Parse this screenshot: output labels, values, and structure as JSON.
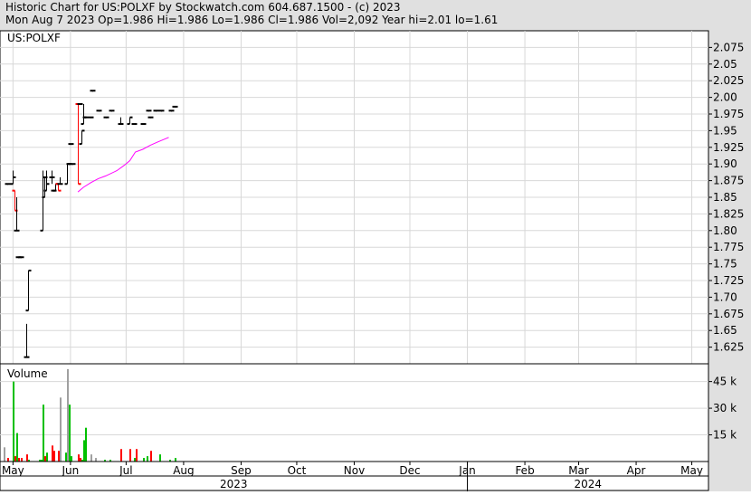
{
  "header": {
    "line1": "Historic Chart for US:POLXF by Stockwatch.com 604.687.1500 - (c) 2023",
    "line2": "Mon Aug  7 2023  Op=1.986  Hi=1.986  Lo=1.986  Cl=1.986  Vol=2,092  Year hi=2.01  lo=1.61"
  },
  "colors": {
    "frame_bg": "#e0e0e0",
    "plot_bg": "#ffffff",
    "grid": "#d8d8d8",
    "up": "#000000",
    "down": "#ff0000",
    "moving_average": "#ff00ff",
    "vol_up": "#00c000",
    "vol_down": "#ff0000",
    "vol_neutral": "#a0a0a0"
  },
  "chart_data": [
    {
      "type": "ohlc",
      "title": "US:POLXF",
      "ylim": [
        1.6,
        2.1
      ],
      "yticks": [
        "2.075",
        "2.05",
        "2.025",
        "2.00",
        "1.975",
        "1.95",
        "1.925",
        "1.90",
        "1.875",
        "1.85",
        "1.825",
        "1.80",
        "1.775",
        "1.75",
        "1.725",
        "1.70",
        "1.675",
        "1.65",
        "1.625"
      ],
      "grid": true,
      "bars": [
        {
          "date": "2023-04-28",
          "open": 1.87,
          "high": 1.87,
          "low": 1.87,
          "close": 1.87
        },
        {
          "date": "2023-05-01",
          "open": 1.87,
          "high": 1.89,
          "low": 1.87,
          "close": 1.88
        },
        {
          "date": "2023-05-02",
          "open": 1.86,
          "high": 1.86,
          "low": 1.83,
          "close": 1.83
        },
        {
          "date": "2023-05-03",
          "open": 1.8,
          "high": 1.85,
          "low": 1.8,
          "close": 1.8
        },
        {
          "date": "2023-05-04",
          "open": 1.76,
          "high": 1.76,
          "low": 1.76,
          "close": 1.76
        },
        {
          "date": "2023-05-05",
          "open": 1.76,
          "high": 1.76,
          "low": 1.76,
          "close": 1.76
        },
        {
          "date": "2023-05-08",
          "open": 1.61,
          "high": 1.66,
          "low": 1.61,
          "close": 1.61
        },
        {
          "date": "2023-05-09",
          "open": 1.68,
          "high": 1.74,
          "low": 1.68,
          "close": 1.74
        },
        {
          "date": "2023-05-17",
          "open": 1.8,
          "high": 1.89,
          "low": 1.8,
          "close": 1.88
        },
        {
          "date": "2023-05-18",
          "open": 1.85,
          "high": 1.88,
          "low": 1.85,
          "close": 1.88
        },
        {
          "date": "2023-05-19",
          "open": 1.86,
          "high": 1.89,
          "low": 1.86,
          "close": 1.87
        },
        {
          "date": "2023-05-22",
          "open": 1.88,
          "high": 1.89,
          "low": 1.87,
          "close": 1.88
        },
        {
          "date": "2023-05-23",
          "open": 1.86,
          "high": 1.86,
          "low": 1.86,
          "close": 1.86
        },
        {
          "date": "2023-05-24",
          "open": 1.86,
          "high": 1.87,
          "low": 1.86,
          "close": 1.87
        },
        {
          "date": "2023-05-25",
          "open": 1.87,
          "high": 1.87,
          "low": 1.86,
          "close": 1.86
        },
        {
          "date": "2023-05-26",
          "open": 1.87,
          "high": 1.88,
          "low": 1.87,
          "close": 1.87
        },
        {
          "date": "2023-05-30",
          "open": 1.87,
          "high": 1.9,
          "low": 1.87,
          "close": 1.9
        },
        {
          "date": "2023-05-31",
          "open": 1.9,
          "high": 1.9,
          "low": 1.9,
          "close": 1.9
        },
        {
          "date": "2023-06-01",
          "open": 1.93,
          "high": 1.93,
          "low": 1.93,
          "close": 1.93
        },
        {
          "date": "2023-06-02",
          "open": 1.9,
          "high": 1.9,
          "low": 1.9,
          "close": 1.9
        },
        {
          "date": "2023-06-05",
          "open": 1.99,
          "high": 1.99,
          "low": 1.87,
          "close": 1.87
        },
        {
          "date": "2023-06-06",
          "open": 1.99,
          "high": 1.99,
          "low": 1.99,
          "close": 1.99
        },
        {
          "date": "2023-06-07",
          "open": 1.93,
          "high": 1.95,
          "low": 1.93,
          "close": 1.95
        },
        {
          "date": "2023-06-08",
          "open": 1.96,
          "high": 1.99,
          "low": 1.96,
          "close": 1.97
        },
        {
          "date": "2023-06-09",
          "open": 1.97,
          "high": 1.97,
          "low": 1.97,
          "close": 1.97
        },
        {
          "date": "2023-06-12",
          "open": 1.97,
          "high": 1.97,
          "low": 1.97,
          "close": 1.97
        },
        {
          "date": "2023-06-13",
          "open": 2.01,
          "high": 2.01,
          "low": 2.01,
          "close": 2.01
        },
        {
          "date": "2023-06-16",
          "open": 1.98,
          "high": 1.98,
          "low": 1.98,
          "close": 1.98
        },
        {
          "date": "2023-06-20",
          "open": 1.97,
          "high": 1.97,
          "low": 1.97,
          "close": 1.97
        },
        {
          "date": "2023-06-23",
          "open": 1.98,
          "high": 1.98,
          "low": 1.98,
          "close": 1.98
        },
        {
          "date": "2023-06-28",
          "open": 1.96,
          "high": 1.97,
          "low": 1.96,
          "close": 1.96
        },
        {
          "date": "2023-07-03",
          "open": 1.96,
          "high": 1.97,
          "low": 1.96,
          "close": 1.97
        },
        {
          "date": "2023-07-05",
          "open": 1.96,
          "high": 1.96,
          "low": 1.96,
          "close": 1.96
        },
        {
          "date": "2023-07-10",
          "open": 1.96,
          "high": 1.96,
          "low": 1.96,
          "close": 1.96
        },
        {
          "date": "2023-07-13",
          "open": 1.98,
          "high": 1.98,
          "low": 1.98,
          "close": 1.98
        },
        {
          "date": "2023-07-14",
          "open": 1.97,
          "high": 1.97,
          "low": 1.97,
          "close": 1.97
        },
        {
          "date": "2023-07-17",
          "open": 1.98,
          "high": 1.98,
          "low": 1.98,
          "close": 1.98
        },
        {
          "date": "2023-07-20",
          "open": 1.98,
          "high": 1.98,
          "low": 1.98,
          "close": 1.98
        },
        {
          "date": "2023-07-25",
          "open": 1.98,
          "high": 1.98,
          "low": 1.98,
          "close": 1.98
        },
        {
          "date": "2023-07-27",
          "open": 1.986,
          "high": 1.986,
          "low": 1.986,
          "close": 1.986
        }
      ],
      "moving_average": [
        {
          "date": "2023-06-05",
          "value": 1.858
        },
        {
          "date": "2023-06-08",
          "value": 1.865
        },
        {
          "date": "2023-06-12",
          "value": 1.872
        },
        {
          "date": "2023-06-16",
          "value": 1.878
        },
        {
          "date": "2023-06-20",
          "value": 1.882
        },
        {
          "date": "2023-06-26",
          "value": 1.89
        },
        {
          "date": "2023-06-30",
          "value": 1.898
        },
        {
          "date": "2023-07-03",
          "value": 1.905
        },
        {
          "date": "2023-07-06",
          "value": 1.918
        },
        {
          "date": "2023-07-10",
          "value": 1.922
        },
        {
          "date": "2023-07-14",
          "value": 1.928
        },
        {
          "date": "2023-07-18",
          "value": 1.933
        },
        {
          "date": "2023-07-24",
          "value": 1.94
        }
      ]
    },
    {
      "type": "bar",
      "title": "Volume",
      "ylim": [
        0,
        55
      ],
      "yticks": [
        "45 k",
        "30 k",
        "15 k"
      ],
      "grid": true,
      "bars": [
        {
          "date": "2023-04-26",
          "value": 8,
          "dir": "neutral"
        },
        {
          "date": "2023-04-28",
          "value": 2,
          "dir": "down"
        },
        {
          "date": "2023-05-01",
          "value": 45,
          "dir": "up"
        },
        {
          "date": "2023-05-02",
          "value": 3,
          "dir": "down"
        },
        {
          "date": "2023-05-03",
          "value": 16,
          "dir": "up"
        },
        {
          "date": "2023-05-04",
          "value": 2,
          "dir": "down"
        },
        {
          "date": "2023-05-05",
          "value": 2,
          "dir": "down"
        },
        {
          "date": "2023-05-08",
          "value": 4,
          "dir": "down"
        },
        {
          "date": "2023-05-09",
          "value": 1,
          "dir": "up"
        },
        {
          "date": "2023-05-15",
          "value": 1,
          "dir": "up"
        },
        {
          "date": "2023-05-16",
          "value": 1,
          "dir": "up"
        },
        {
          "date": "2023-05-17",
          "value": 32,
          "dir": "up"
        },
        {
          "date": "2023-05-18",
          "value": 3,
          "dir": "down"
        },
        {
          "date": "2023-05-19",
          "value": 5,
          "dir": "up"
        },
        {
          "date": "2023-05-22",
          "value": 9,
          "dir": "down"
        },
        {
          "date": "2023-05-23",
          "value": 6,
          "dir": "down"
        },
        {
          "date": "2023-05-25",
          "value": 6,
          "dir": "down"
        },
        {
          "date": "2023-05-26",
          "value": 36,
          "dir": "neutral"
        },
        {
          "date": "2023-05-29",
          "value": 5,
          "dir": "up"
        },
        {
          "date": "2023-05-30",
          "value": 52,
          "dir": "neutral"
        },
        {
          "date": "2023-05-31",
          "value": 32,
          "dir": "up"
        },
        {
          "date": "2023-06-01",
          "value": 3,
          "dir": "up"
        },
        {
          "date": "2023-06-05",
          "value": 4,
          "dir": "down"
        },
        {
          "date": "2023-06-06",
          "value": 2,
          "dir": "down"
        },
        {
          "date": "2023-06-07",
          "value": 1,
          "dir": "up"
        },
        {
          "date": "2023-06-08",
          "value": 12,
          "dir": "up"
        },
        {
          "date": "2023-06-09",
          "value": 19,
          "dir": "up"
        },
        {
          "date": "2023-06-12",
          "value": 4,
          "dir": "neutral"
        },
        {
          "date": "2023-06-14",
          "value": 2,
          "dir": "neutral"
        },
        {
          "date": "2023-06-19",
          "value": 1,
          "dir": "up"
        },
        {
          "date": "2023-06-22",
          "value": 1,
          "dir": "up"
        },
        {
          "date": "2023-06-28",
          "value": 7,
          "dir": "down"
        },
        {
          "date": "2023-07-03",
          "value": 7,
          "dir": "down"
        },
        {
          "date": "2023-07-05",
          "value": 2,
          "dir": "up"
        },
        {
          "date": "2023-07-06",
          "value": 7,
          "dir": "down"
        },
        {
          "date": "2023-07-10",
          "value": 2,
          "dir": "up"
        },
        {
          "date": "2023-07-12",
          "value": 3,
          "dir": "up"
        },
        {
          "date": "2023-07-14",
          "value": 6,
          "dir": "down"
        },
        {
          "date": "2023-07-19",
          "value": 4,
          "dir": "up"
        },
        {
          "date": "2023-07-24",
          "value": 1,
          "dir": "up"
        },
        {
          "date": "2023-07-27",
          "value": 2,
          "dir": "up"
        }
      ]
    }
  ],
  "x_axis": {
    "start": "2023-04-24",
    "end": "2024-05-10",
    "months": [
      {
        "label": "May",
        "date": "2023-05-01"
      },
      {
        "label": "Jun",
        "date": "2023-06-01"
      },
      {
        "label": "Jul",
        "date": "2023-07-01"
      },
      {
        "label": "Aug",
        "date": "2023-08-01"
      },
      {
        "label": "Sep",
        "date": "2023-09-01"
      },
      {
        "label": "Oct",
        "date": "2023-10-01"
      },
      {
        "label": "Nov",
        "date": "2023-11-01"
      },
      {
        "label": "Dec",
        "date": "2023-12-01"
      },
      {
        "label": "Jan",
        "date": "2024-01-01"
      },
      {
        "label": "Feb",
        "date": "2024-02-01"
      },
      {
        "label": "Mar",
        "date": "2024-03-01"
      },
      {
        "label": "Apr",
        "date": "2024-04-01"
      },
      {
        "label": "May",
        "date": "2024-05-01"
      }
    ],
    "years": [
      {
        "label": "2023",
        "from": "2023-04-24",
        "to": "2024-01-01"
      },
      {
        "label": "2024",
        "from": "2024-01-01",
        "to": "2024-05-10"
      }
    ]
  }
}
